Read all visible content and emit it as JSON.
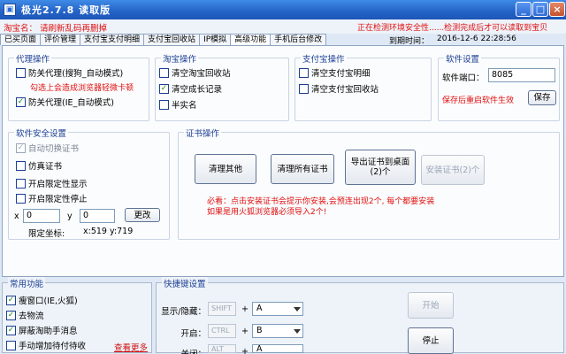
{
  "window": {
    "icon_glyph": "▣",
    "title": "极光2.7.8   读取版",
    "controls": {
      "minimize": "_",
      "maximize": "□",
      "close": "×"
    }
  },
  "header": {
    "hint": "淘宝名：  请刷新乱码再删掉",
    "detect_msg": "正在检测环境安全性......检测完成后才可以读取到宝贝",
    "expire_label": "到期时间：",
    "expire_value": "2016-12-6 22:28:56"
  },
  "tabs": [
    "已买页面",
    "评价管理",
    "支付宝支付明细",
    "支付宝回收站",
    "IP模拟",
    "高级功能",
    "手机后台修改"
  ],
  "proxy": {
    "title": "代理操作",
    "opt1": "防关代理(搜狗_自动模式)",
    "warn": "勾选上会造成浏览器轻微卡顿",
    "opt2": "防关代理(IE_自动模式)"
  },
  "taobao": {
    "title": "淘宝操作",
    "opt1": "清空淘宝回收站",
    "opt2": "清空成长记录",
    "opt3": "半实名"
  },
  "alipay": {
    "title": "支付宝操作",
    "opt1": "清空支付宝明细",
    "opt2": "清空支付宝回收站"
  },
  "software": {
    "title": "软件设置",
    "port_label": "软件端口：",
    "port_value": "8085",
    "restart_tip": "保存后重启软件生效",
    "save": "保存"
  },
  "security": {
    "title": "软件安全设置",
    "opt1": "自动切换证书",
    "opt2": "仿真证书",
    "opt3": "开启限定性显示",
    "opt4": "开启限定性停止",
    "x_label": "x",
    "x_value": "0",
    "y_label": "y",
    "y_value": "0",
    "change": "更改",
    "coord_label": "限定坐标:",
    "coord_value": "x:519 y:719"
  },
  "cert": {
    "title": "证书操作",
    "btn1": "清理其他",
    "btn2": "清理所有证书",
    "btn3": "导出证书到桌面(2)个",
    "btn4": "安装证书(2)个",
    "notice1": "必看：点击安装证书会提示你安装,会预连出现2个, 每个都要安装",
    "notice2": "如果是用火狐浏览器必须导入2个!"
  },
  "common": {
    "title": "常用功能",
    "opt1": "瘦窗口(IE,火狐)",
    "opt2": "去物流",
    "opt3": "屏蔽淘助手消息",
    "opt4": "手动增加待付待收",
    "more": "查看更多"
  },
  "hotkeys": {
    "title": "快捷键设置",
    "show_label": "显示/隐藏：",
    "show_mod": "SHIFT",
    "show_key": "A",
    "start_label": "开启：",
    "start_mod": "CTRL",
    "start_key": "B",
    "close_label": "关闭：",
    "close_mod": "ALT",
    "close_key": "A",
    "plus": "+",
    "begin": "开始",
    "stop": "停止"
  },
  "checkmark": "✓"
}
